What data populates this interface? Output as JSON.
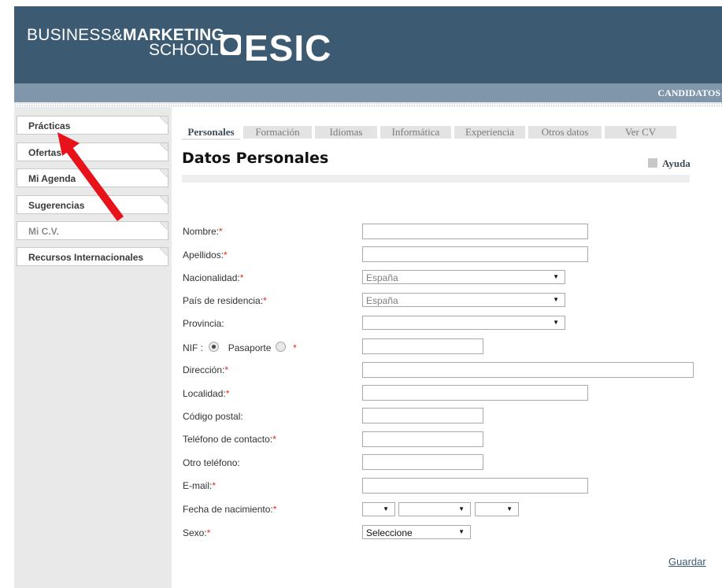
{
  "header": {
    "logo_line1_a": "BUSINESS&",
    "logo_line1_b": "MARKETING",
    "logo_line2": "SCHOOL",
    "logo_brand": "ESIC",
    "section": "CANDIDATOS"
  },
  "sidebar": {
    "items": [
      {
        "label": "Prácticas"
      },
      {
        "label": "Ofertas"
      },
      {
        "label": "Mi Agenda"
      },
      {
        "label": "Sugerencias"
      },
      {
        "label": "Mi C.V."
      },
      {
        "label": "Recursos Internacionales"
      }
    ]
  },
  "tabs": [
    {
      "label": "Personales",
      "active": true
    },
    {
      "label": "Formación"
    },
    {
      "label": "Idiomas"
    },
    {
      "label": "Informática"
    },
    {
      "label": "Experiencia"
    },
    {
      "label": "Otros datos"
    },
    {
      "label": "Ver CV"
    }
  ],
  "page": {
    "title": "Datos Personales",
    "help": "Ayuda"
  },
  "form": {
    "nombre": "Nombre:",
    "apellidos": "Apellidos:",
    "nacionalidad": "Nacionalidad:",
    "nacionalidad_value": "España",
    "pais": "País de residencia:",
    "pais_value": "España",
    "provincia": "Provincia:",
    "nif": "NIF :",
    "pasaporte": "Pasaporte",
    "direccion": "Dirección:",
    "localidad": "Localidad:",
    "codigo_postal": "Código postal:",
    "telefono": "Teléfono de contacto:",
    "otro_telefono": "Otro teléfono:",
    "email": "E-mail:",
    "fecha_nacimiento": "Fecha de nacimiento:",
    "sexo": "Sexo:",
    "sexo_value": "Seleccione",
    "required_mark": "*",
    "save": "Guardar"
  },
  "colors": {
    "header": "#3d5a73",
    "subbar": "#7f96ab",
    "required": "#e32626",
    "arrow": "#e8121b"
  }
}
